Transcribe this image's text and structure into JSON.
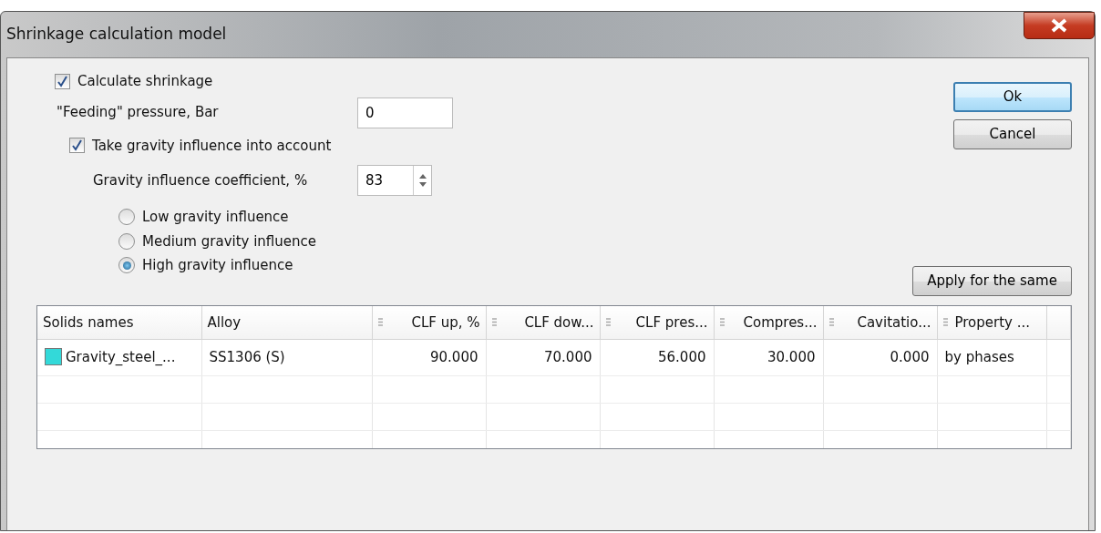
{
  "window": {
    "title": "Shrinkage calculation model"
  },
  "calculate_shrinkage": {
    "label": "Calculate shrinkage",
    "checked": true
  },
  "feeding_pressure": {
    "label": "\"Feeding\" pressure, Bar",
    "value": "0"
  },
  "gravity_influence": {
    "label": "Take gravity influence into account",
    "checked": true
  },
  "gravity_coefficient": {
    "label": "Gravity influence coefficient, %",
    "value": "83"
  },
  "gravity_levels": [
    {
      "label": "Low gravity influence",
      "selected": false
    },
    {
      "label": "Medium gravity influence",
      "selected": false
    },
    {
      "label": "High gravity influence",
      "selected": true
    }
  ],
  "buttons": [
    {
      "label": "Ok",
      "default": true
    },
    {
      "label": "Cancel",
      "default": false
    }
  ],
  "apply_button": {
    "label": "Apply for the same"
  },
  "table": {
    "columns": [
      {
        "label": "Solids names",
        "kind": "text",
        "grip": false
      },
      {
        "label": "Alloy",
        "kind": "text",
        "grip": false
      },
      {
        "label": "CLF up, %",
        "kind": "number",
        "grip": true
      },
      {
        "label": "CLF dow...",
        "kind": "number",
        "grip": true
      },
      {
        "label": "CLF pres...",
        "kind": "number",
        "grip": true
      },
      {
        "label": "Compres...",
        "kind": "number",
        "grip": true
      },
      {
        "label": "Cavitatio...",
        "kind": "number",
        "grip": true
      },
      {
        "label": "Property ...",
        "kind": "text",
        "grip": true
      }
    ],
    "rows": [
      {
        "color": "#33d9d9",
        "cells": [
          "Gravity_steel_...",
          "SS1306 (S)",
          "90.000",
          "70.000",
          "56.000",
          "30.000",
          "0.000",
          "by phases"
        ]
      }
    ]
  }
}
